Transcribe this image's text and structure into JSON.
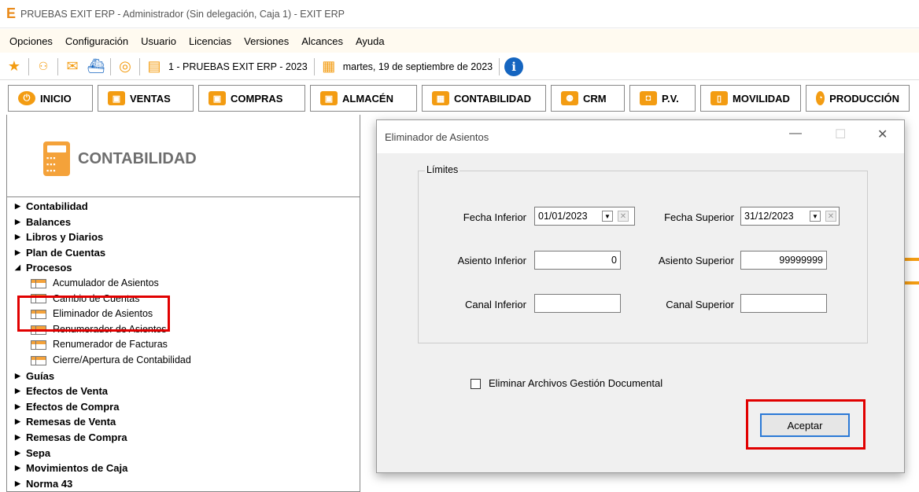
{
  "window": {
    "title": "PRUEBAS EXIT ERP - Administrador (Sin delegación, Caja 1) - EXIT ERP"
  },
  "menu": [
    "Opciones",
    "Configuración",
    "Usuario",
    "Licencias",
    "Versiones",
    "Alcances",
    "Ayuda"
  ],
  "toolbar": {
    "company": "1 - PRUEBAS EXIT ERP - 2023",
    "date": "martes, 19 de septiembre de 2023",
    "icons": [
      "star-icon",
      "users-icon",
      "envelope-icon",
      "ship-icon",
      "target-icon",
      "document-icon",
      "calendar-icon",
      "info-icon"
    ]
  },
  "modules": [
    {
      "label": "INICIO",
      "icon": "power-icon",
      "color": "#f39c12"
    },
    {
      "label": "VENTAS",
      "icon": "box-icon",
      "color": "#f39c12"
    },
    {
      "label": "COMPRAS",
      "icon": "box-icon",
      "color": "#f39c12"
    },
    {
      "label": "ALMACÉN",
      "icon": "box-icon",
      "color": "#f39c12"
    },
    {
      "label": "CONTABILIDAD",
      "icon": "calculator-icon",
      "color": "#f39c12"
    },
    {
      "label": "CRM",
      "icon": "people-icon",
      "color": "#f39c12"
    },
    {
      "label": "P.V.",
      "icon": "bag-icon",
      "color": "#f39c12"
    },
    {
      "label": "MOVILIDAD",
      "icon": "phone-icon",
      "color": "#f39c12"
    },
    {
      "label": "PRODUCCIÓN",
      "icon": "chart-icon",
      "color": "#f39c12"
    }
  ],
  "section": {
    "title": "CONTABILIDAD"
  },
  "tree": [
    {
      "type": "node",
      "label": "Contabilidad",
      "expanded": false
    },
    {
      "type": "node",
      "label": "Balances",
      "expanded": false
    },
    {
      "type": "node",
      "label": "Libros y Diarios",
      "expanded": false
    },
    {
      "type": "node",
      "label": "Plan de Cuentas",
      "expanded": false
    },
    {
      "type": "node",
      "label": "Procesos",
      "expanded": true
    },
    {
      "type": "leaf",
      "label": "Acumulador de Asientos"
    },
    {
      "type": "leaf",
      "label": "Cambio de Cuentas"
    },
    {
      "type": "leaf",
      "label": "Eliminador de Asientos"
    },
    {
      "type": "leaf",
      "label": "Renumerador de Asientos"
    },
    {
      "type": "leaf",
      "label": "Renumerador de Facturas"
    },
    {
      "type": "leaf",
      "label": "Cierre/Apertura de Contabilidad"
    },
    {
      "type": "node",
      "label": "Guías",
      "expanded": false
    },
    {
      "type": "node",
      "label": "Efectos de Venta",
      "expanded": false
    },
    {
      "type": "node",
      "label": "Efectos de Compra",
      "expanded": false
    },
    {
      "type": "node",
      "label": "Remesas de Venta",
      "expanded": false
    },
    {
      "type": "node",
      "label": "Remesas de Compra",
      "expanded": false
    },
    {
      "type": "node",
      "label": "Sepa",
      "expanded": false
    },
    {
      "type": "node",
      "label": "Movimientos de Caja",
      "expanded": false
    },
    {
      "type": "node",
      "label": "Norma 43",
      "expanded": false
    }
  ],
  "dialog": {
    "title": "Eliminador de Asientos",
    "group_label": "Límites",
    "fecha_inferior_label": "Fecha Inferior",
    "fecha_inferior_value": "01/01/2023",
    "fecha_superior_label": "Fecha Superior",
    "fecha_superior_value": "31/12/2023",
    "asiento_inferior_label": "Asiento Inferior",
    "asiento_inferior_value": "0",
    "asiento_superior_label": "Asiento Superior",
    "asiento_superior_value": "99999999",
    "canal_inferior_label": "Canal Inferior",
    "canal_inferior_value": "",
    "canal_superior_label": "Canal Superior",
    "canal_superior_value": "",
    "checkbox_label": "Eliminar Archivos Gestión Documental",
    "checkbox_checked": false,
    "ok_label": "Aceptar"
  },
  "colors": {
    "accent": "#f39c12",
    "highlight": "#e10000",
    "button_focus": "#2b79d6"
  }
}
